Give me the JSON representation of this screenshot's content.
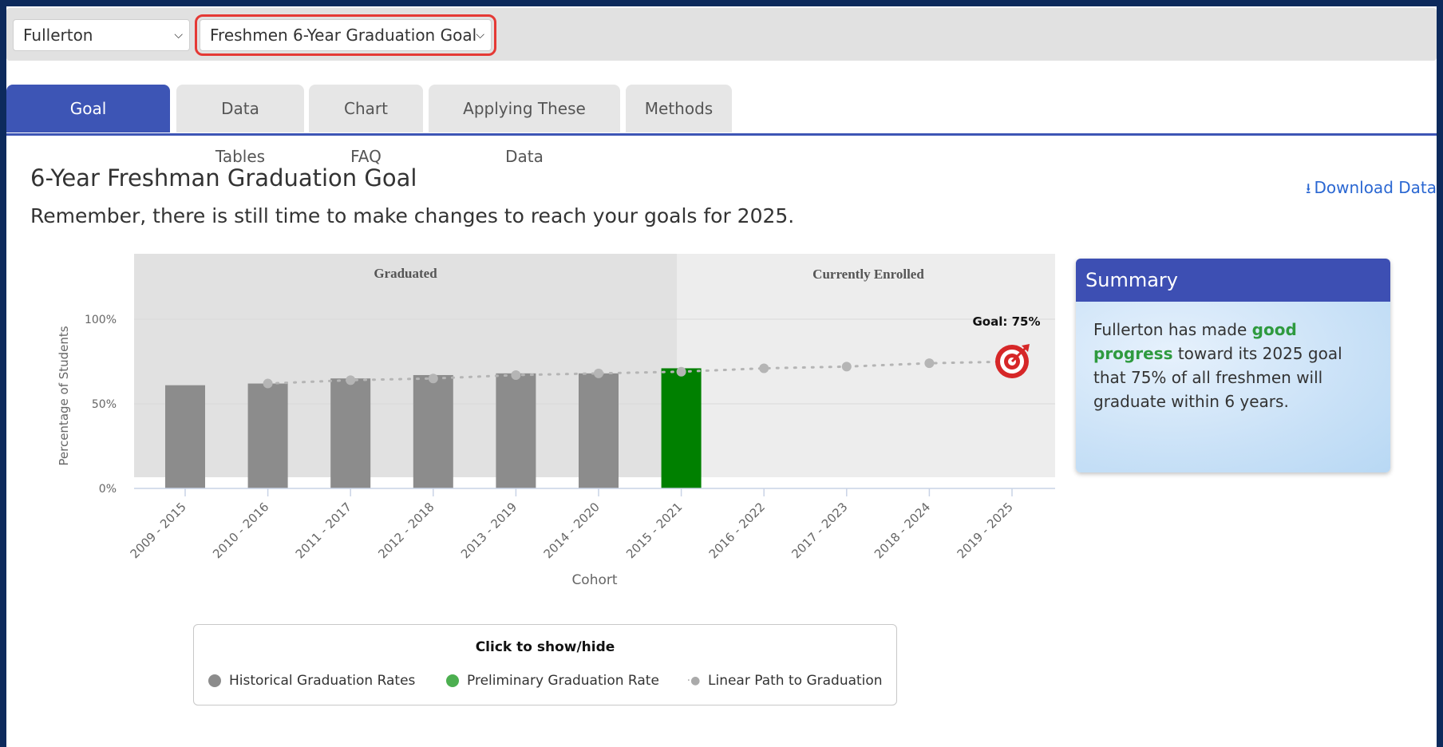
{
  "filters": {
    "campus": "Fullerton",
    "metric": "Freshmen 6-Year Graduation Goal"
  },
  "tabs": [
    "Goal Trajectories",
    "Data Tables",
    "Chart FAQ",
    "Applying These Data",
    "Methods"
  ],
  "download_label": "Download Data",
  "heading": "6-Year Freshman Graduation Goal",
  "subheading": "Remember, there is still time to make changes to reach your goals for 2025.",
  "chart_data": {
    "type": "bar",
    "xlabel": "Cohort",
    "ylabel": "Percentage of Students",
    "ylim": [
      0,
      100
    ],
    "yticks": [
      "0%",
      "50%",
      "100%"
    ],
    "regions": [
      "Graduated",
      "Currently Enrolled"
    ],
    "categories": [
      "2009 - 2015",
      "2010 - 2016",
      "2011 - 2017",
      "2012 - 2018",
      "2013 - 2019",
      "2014 - 2020",
      "2015 - 2021",
      "2016 - 2022",
      "2017 - 2023",
      "2018 - 2024",
      "2019 - 2025"
    ],
    "series": [
      {
        "name": "Historical Graduation Rates",
        "values": [
          61,
          62,
          65,
          67,
          68,
          68,
          null,
          null,
          null,
          null,
          null
        ]
      },
      {
        "name": "Preliminary Graduation Rate",
        "values": [
          null,
          null,
          null,
          null,
          null,
          null,
          71,
          null,
          null,
          null,
          null
        ]
      },
      {
        "name": "Linear Path to Graduation",
        "values": [
          null,
          62,
          64,
          65,
          67,
          68,
          69,
          71,
          72,
          74,
          75
        ]
      }
    ],
    "goal_label": "Goal: 75%",
    "colors": {
      "historical": "#8c8c8c",
      "preliminary": "#008000",
      "path": "#b5b5b5",
      "goal": "#d62728"
    }
  },
  "legend": {
    "title": "Click to show/hide",
    "items": [
      "Historical Graduation Rates",
      "Preliminary Graduation Rate",
      "Linear Path to Graduation"
    ]
  },
  "summary": {
    "title": "Summary",
    "text_before": "Fullerton has made ",
    "highlight": "good progress",
    "text_after": " toward its 2025 goal that 75% of all freshmen will graduate within 6 years."
  }
}
